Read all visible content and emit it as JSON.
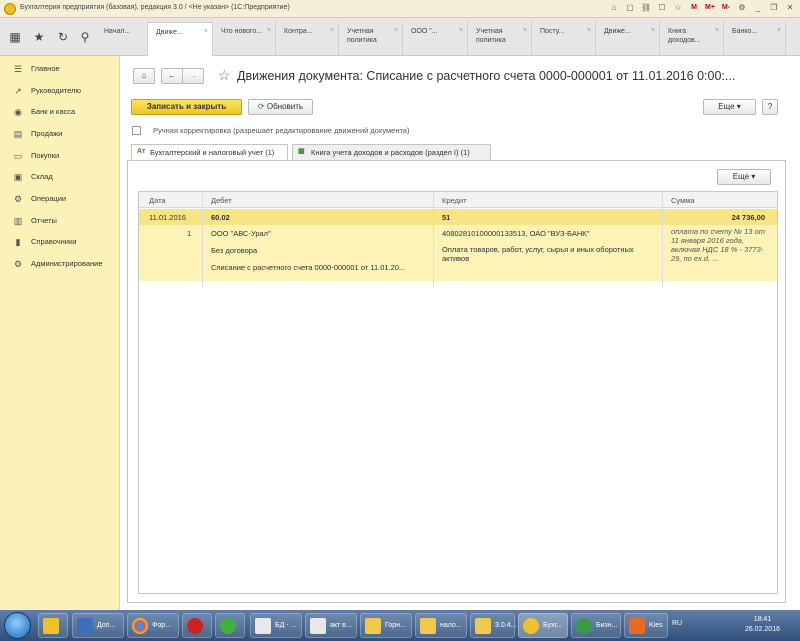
{
  "window": {
    "title": "Бухгалтерия предприятия (базовая), редакция 3.0 / <Не указан> (1С:Предприятие)"
  },
  "tabs": [
    {
      "label": "Начал..."
    },
    {
      "label": "Движе..."
    },
    {
      "label": "Что нового..."
    },
    {
      "label": "Контра..."
    },
    {
      "label": "Учетная политика"
    },
    {
      "label": "ООО \"..."
    },
    {
      "label": "Учетная политика"
    },
    {
      "label": "Посту..."
    },
    {
      "label": "Движе..."
    },
    {
      "label": "Книга доходов..."
    },
    {
      "label": "Банко..."
    }
  ],
  "sidebar": {
    "items": [
      {
        "label": "Главное",
        "icon": "menu-icon"
      },
      {
        "label": "Руководителю",
        "icon": "chart-line-icon"
      },
      {
        "label": "Банк и касса",
        "icon": "bank-icon"
      },
      {
        "label": "Продажи",
        "icon": "cart-icon"
      },
      {
        "label": "Покупки",
        "icon": "basket-icon"
      },
      {
        "label": "Склад",
        "icon": "warehouse-icon"
      },
      {
        "label": "Операции",
        "icon": "operations-icon"
      },
      {
        "label": "Отчеты",
        "icon": "report-icon"
      },
      {
        "label": "Справочники",
        "icon": "book-icon"
      },
      {
        "label": "Администрирование",
        "icon": "gear-icon"
      }
    ]
  },
  "document": {
    "title": "Движения документа: Списание с расчетного счета 0000-000001 от 11.01.2016 0:00:...",
    "save_close_label": "Записать и закрыть",
    "refresh_label": "Обновить",
    "more_label": "Еще",
    "help_label": "?",
    "manual_label": "Ручная корректировка (разрешает редактирование движений документа)",
    "tabs": [
      {
        "label": "Бухгалтерский и налоговый учет (1)"
      },
      {
        "label": "Книга учета доходов и расходов (раздел I) (1)"
      }
    ],
    "grid_more_label": "Еще"
  },
  "grid": {
    "columns": [
      "Дата",
      "Дебет",
      "Кредит",
      "Сумма"
    ],
    "row": {
      "date": "11.01.2016",
      "debit": "60.02",
      "credit": "51",
      "sum": "24 736,00",
      "num": "1",
      "debit_sub1": "ООО \"АВС-Урал\"",
      "debit_sub2": "Без договора",
      "debit_sub3": "Списание с расчетного счета 0000-000001 от 11.01.20...",
      "credit_sub1": "40802810100000133513, ОАО \"ВУЗ-БАНК\"",
      "credit_sub2": "Оплата товаров, работ, услуг, сырья и иных оборотных активов",
      "sum_comment": "оплата по счету № 13 от 11 января 2016 года, включая НДС 18 % - 3773-29, по ex.d. ..."
    }
  },
  "taskbar": {
    "items": [
      {
        "label": "Доп..."
      },
      {
        "label": "Фор..."
      },
      {
        "label": ""
      },
      {
        "label": ""
      },
      {
        "label": "БД - ..."
      },
      {
        "label": "акт в..."
      },
      {
        "label": "Горн..."
      },
      {
        "label": "нало..."
      },
      {
        "label": "3.0.4..."
      },
      {
        "label": "Бухг..."
      },
      {
        "label": "Бизн..."
      },
      {
        "label": "Kies"
      }
    ],
    "lang": "RU",
    "time": "18:41",
    "date": "26.02.2016"
  }
}
